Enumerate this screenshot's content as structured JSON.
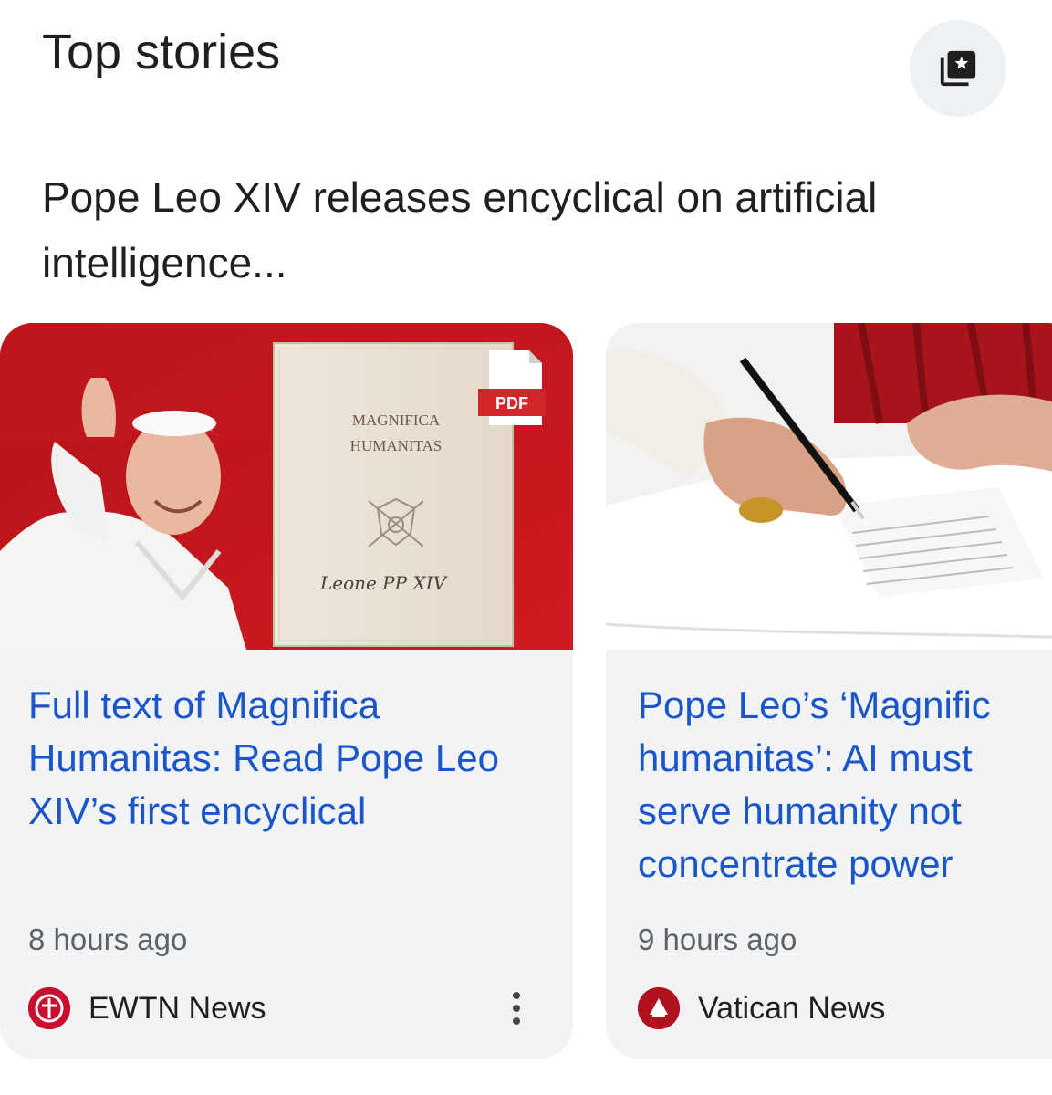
{
  "section": {
    "title": "Top stories",
    "save_icon": "bookmark-star-icon"
  },
  "headline": "Pope Leo XIV releases encyclical on artificial intelligence...",
  "cards": [
    {
      "title": "Full text of Magnifica Humanitas: Read Pope Leo XIV’s first encyclical",
      "time": "8 hours ago",
      "source": "EWTN News",
      "image": {
        "book_title_line1": "MAGNIFICA",
        "book_title_line2": "HUMANITAS",
        "signature": "Leone PP XIV",
        "badge": "PDF"
      }
    },
    {
      "title": "Pope Leo’s ‘Magnific\nhumanitas’: AI must\nserve humanity not\nconcentrate power",
      "time": "9 hours ago",
      "source": "Vatican News"
    }
  ],
  "colors": {
    "link_blue": "#1a55c9",
    "card_bg": "#f1f3f5",
    "ewtn_red": "#c8102e"
  }
}
